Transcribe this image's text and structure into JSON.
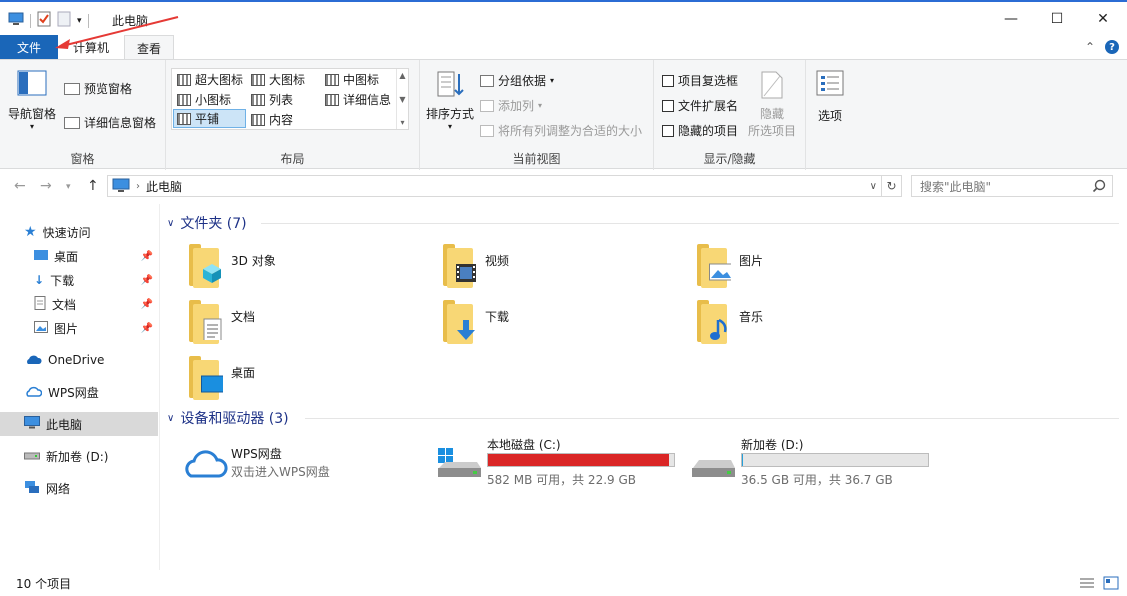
{
  "window": {
    "title": "此电脑"
  },
  "tabs": {
    "file": "文件",
    "computer": "计算机",
    "view": "查看"
  },
  "ribbon": {
    "pane": {
      "nav_pane_label": "导航窗格",
      "preview_pane_label": "预览窗格",
      "details_pane_label": "详细信息窗格",
      "group_label": "窗格"
    },
    "layout": {
      "items": [
        "超大图标",
        "大图标",
        "中图标",
        "小图标",
        "列表",
        "详细信息",
        "平铺",
        "内容"
      ],
      "selected": "平铺",
      "group_label": "布局"
    },
    "current_view": {
      "sort_label": "排序方式",
      "group_by_label": "分组依据",
      "add_column_label": "添加列",
      "fit_columns_label": "将所有列调整为合适的大小",
      "group_label": "当前视图"
    },
    "show_hide": {
      "item_checkbox_label": "项目复选框",
      "file_ext_label": "文件扩展名",
      "hidden_items_label": "隐藏的项目",
      "hide_selected_line1": "隐藏",
      "hide_selected_line2": "所选项目",
      "group_label": "显示/隐藏"
    },
    "options_label": "选项"
  },
  "address": {
    "path": "此电脑",
    "search_placeholder": "搜索\"此电脑\""
  },
  "sidebar": {
    "quick_access": "快速访问",
    "pinned": [
      "桌面",
      "下载",
      "文档",
      "图片"
    ],
    "onedrive": "OneDrive",
    "wps": "WPS网盘",
    "this_pc": "此电脑",
    "new_volume": "新加卷 (D:)",
    "network": "网络"
  },
  "folders_section": {
    "heading": "文件夹 (7)",
    "items": [
      "3D 对象",
      "视频",
      "图片",
      "文档",
      "下载",
      "音乐",
      "桌面"
    ]
  },
  "devices_section": {
    "heading": "设备和驱动器 (3)",
    "wps": {
      "name": "WPS网盘",
      "sub": "双击进入WPS网盘"
    },
    "drive_c": {
      "name": "本地磁盘 (C:)",
      "sub": "582 MB 可用，共 22.9 GB",
      "used_fraction": 0.975,
      "bar_color": "#da2626"
    },
    "drive_d": {
      "name": "新加卷 (D:)",
      "sub": "36.5 GB 可用，共 36.7 GB",
      "used_fraction": 0.006,
      "bar_color": "#26a0da"
    }
  },
  "status": {
    "item_count": "10 个项目"
  },
  "colors": {
    "accent": "#1a66b8",
    "section_heading": "#1e3287",
    "annotation": "#e53935"
  }
}
